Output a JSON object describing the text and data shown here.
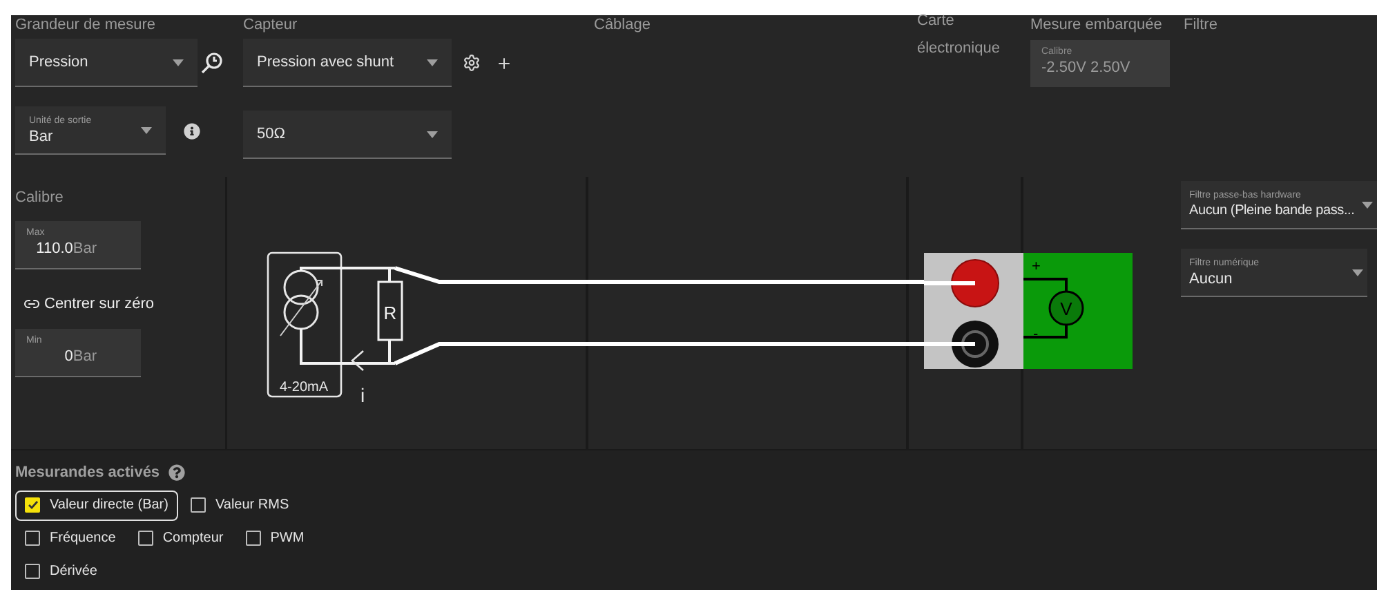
{
  "grandeur": {
    "title": "Grandeur de mesure",
    "select": {
      "value": "Pression"
    },
    "unit": {
      "label": "Unité de sortie",
      "value": "Bar"
    }
  },
  "capteur": {
    "title": "Capteur",
    "select": {
      "value": "Pression avec shunt"
    },
    "resistance": {
      "value": "50Ω"
    }
  },
  "cablage": {
    "title": "Câblage"
  },
  "carte": {
    "title": "Carte électronique"
  },
  "mesure_embarquee": {
    "title": "Mesure embarquée",
    "calibre": {
      "label": "Calibre",
      "value": "-2.50V 2.50V"
    }
  },
  "filtre": {
    "title": "Filtre",
    "fields": [
      {
        "label": "Filtre passe-bas hardware",
        "value": "Aucun (Pleine bande pass..."
      },
      {
        "label": "Filtre numérique",
        "value": "Aucun"
      }
    ]
  },
  "calibre": {
    "title": "Calibre",
    "max": {
      "label": "Max",
      "value": "110.0",
      "unit": "Bar"
    },
    "center_button": "Centrer sur zéro",
    "min": {
      "label": "Min",
      "value": "0",
      "unit": "Bar"
    }
  },
  "diagram": {
    "source_label": "4-20mA",
    "resistor_label": "R",
    "current_label": "i",
    "plus": "+",
    "minus": "-",
    "meter_label": "V"
  },
  "mesurandes": {
    "title": "Mesurandes activés",
    "items": [
      {
        "label": "Valeur directe (Bar)",
        "checked": true,
        "selected": true
      },
      {
        "label": "Valeur RMS",
        "checked": false,
        "selected": false
      },
      {
        "label": "Fréquence",
        "checked": false,
        "selected": false
      },
      {
        "label": "Compteur",
        "checked": false,
        "selected": false
      },
      {
        "label": "PWM",
        "checked": false,
        "selected": false
      },
      {
        "label": "Dérivée",
        "checked": false,
        "selected": false
      }
    ]
  }
}
